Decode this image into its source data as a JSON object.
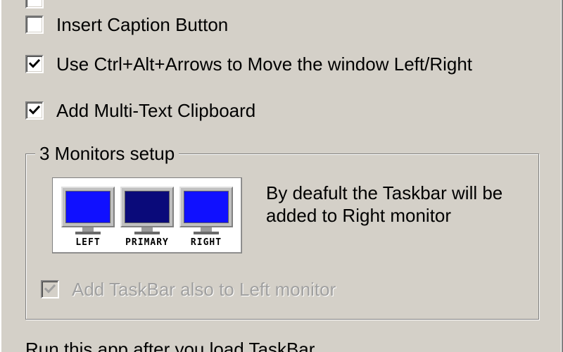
{
  "options": {
    "insert_caption": {
      "label": "Insert Caption Button",
      "checked": false
    },
    "ctrl_alt_arrows": {
      "label": "Use Ctrl+Alt+Arrows to Move the window Left/Right",
      "checked": true
    },
    "multi_text_clipboard": {
      "label": "Add Multi-Text Clipboard",
      "checked": true
    }
  },
  "monitors_group": {
    "title": "3 Monitors setup",
    "monitors": [
      {
        "label": "LEFT",
        "color": "#1010ff"
      },
      {
        "label": "PRIMARY",
        "color": "#0a0a7a"
      },
      {
        "label": "RIGHT",
        "color": "#1010ff"
      }
    ],
    "description": "By deafult the Taskbar will be added to Right monitor",
    "taskbar_left": {
      "label": "Add TaskBar also to Left monitor",
      "checked": true,
      "enabled": false
    }
  },
  "footer": {
    "run_after_text": "Run this app after you load TaskBar"
  }
}
